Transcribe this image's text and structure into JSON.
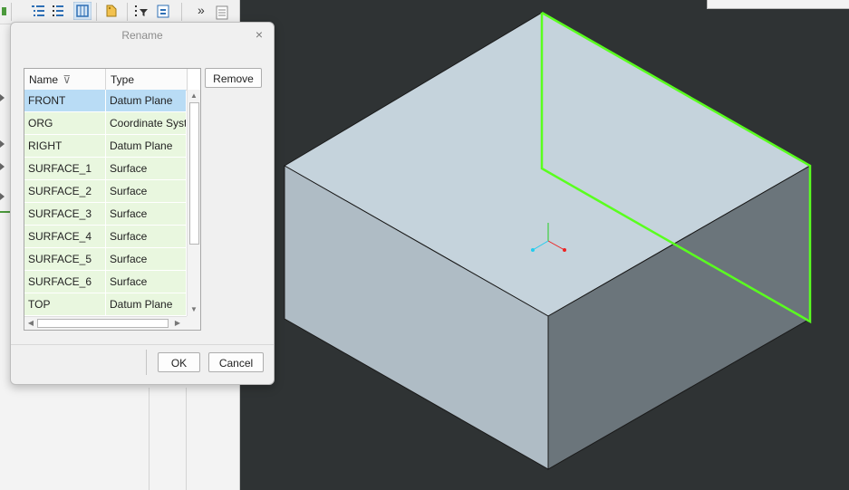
{
  "dialog": {
    "title": "Rename",
    "close_glyph": "×",
    "columns": {
      "name": "Name",
      "type": "Type",
      "filter_glyph": "⊽"
    },
    "rows": [
      {
        "name": "FRONT",
        "type": "Datum Plane",
        "selected": true
      },
      {
        "name": "ORG",
        "type": "Coordinate Syst"
      },
      {
        "name": "RIGHT",
        "type": "Datum Plane"
      },
      {
        "name": "SURFACE_1",
        "type": "Surface"
      },
      {
        "name": "SURFACE_2",
        "type": "Surface"
      },
      {
        "name": "SURFACE_3",
        "type": "Surface"
      },
      {
        "name": "SURFACE_4",
        "type": "Surface"
      },
      {
        "name": "SURFACE_5",
        "type": "Surface"
      },
      {
        "name": "SURFACE_6",
        "type": "Surface"
      },
      {
        "name": "TOP",
        "type": "Datum Plane"
      }
    ],
    "remove_label": "Remove",
    "ok_label": "OK",
    "cancel_label": "Cancel"
  },
  "toolbar": {
    "overflow_glyph": "»"
  },
  "colors": {
    "viewport_bg": "#2f3334",
    "model_top": "#c5d3dc",
    "model_left": "#afbcc5",
    "model_right": "#6b757b",
    "highlight": "#5aff1f",
    "selected_row": "#b9dcf5",
    "row_bg": "#e9f7df"
  },
  "icons": [
    "list-tree-icon",
    "list-detail-icon",
    "show-columns-icon",
    "tag-icon",
    "filter-icon",
    "clipboard-icon",
    "overflow-icon",
    "page-icon"
  ]
}
